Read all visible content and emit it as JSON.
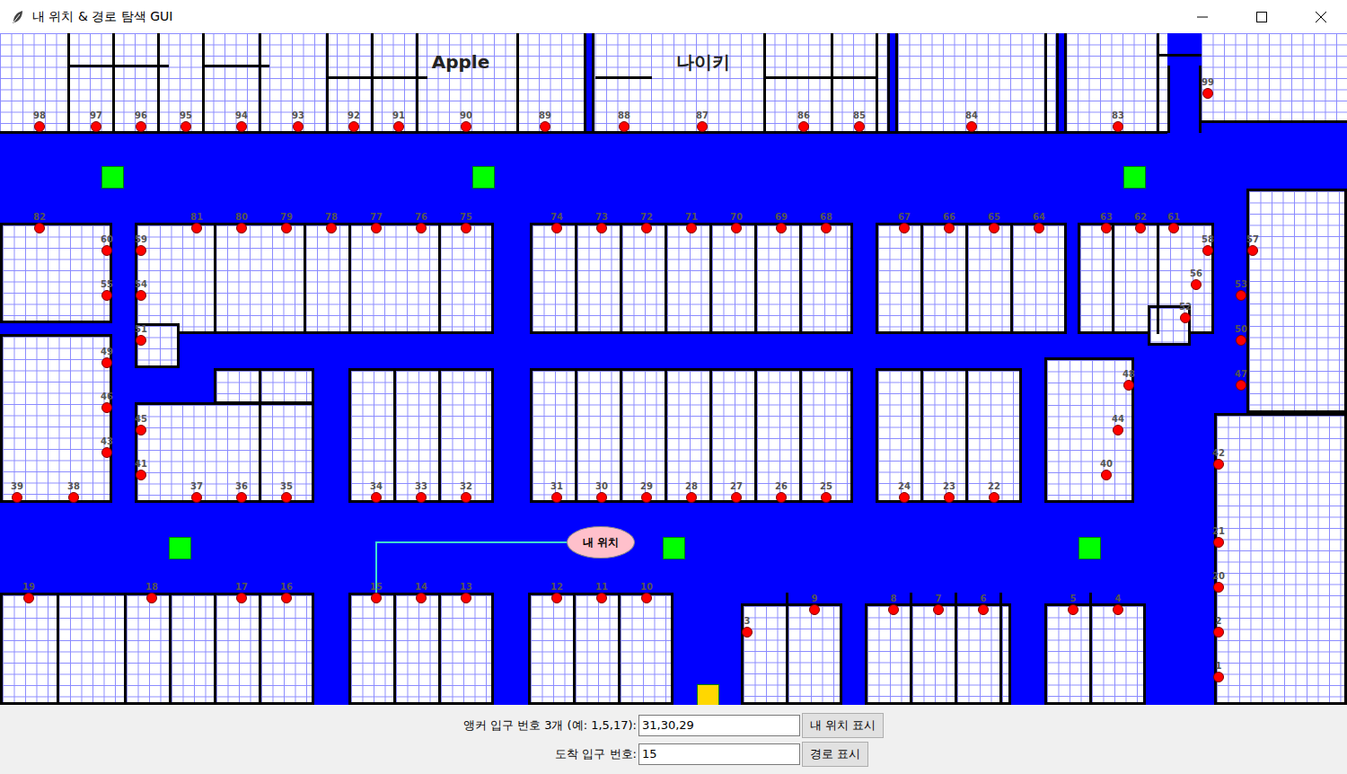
{
  "window": {
    "title": "내 위치 & 경로 탐색 GUI"
  },
  "map": {
    "brands": [
      {
        "label": "Apple"
      },
      {
        "label": "나이키"
      }
    ],
    "entrances": [
      {
        "label": "1"
      },
      {
        "label": "2"
      },
      {
        "label": "3"
      },
      {
        "label": "4"
      },
      {
        "label": "5"
      },
      {
        "label": "6"
      },
      {
        "label": "7"
      },
      {
        "label": "8"
      },
      {
        "label": "9"
      },
      {
        "label": "10"
      },
      {
        "label": "11"
      },
      {
        "label": "12"
      },
      {
        "label": "13"
      },
      {
        "label": "14"
      },
      {
        "label": "15"
      },
      {
        "label": "16"
      },
      {
        "label": "17"
      },
      {
        "label": "18"
      },
      {
        "label": "19"
      },
      {
        "label": "20"
      },
      {
        "label": "21"
      },
      {
        "label": "22"
      },
      {
        "label": "23"
      },
      {
        "label": "24"
      },
      {
        "label": "25"
      },
      {
        "label": "26"
      },
      {
        "label": "27"
      },
      {
        "label": "28"
      },
      {
        "label": "29"
      },
      {
        "label": "30"
      },
      {
        "label": "31"
      },
      {
        "label": "32"
      },
      {
        "label": "33"
      },
      {
        "label": "34"
      },
      {
        "label": "35"
      },
      {
        "label": "36"
      },
      {
        "label": "37"
      },
      {
        "label": "38"
      },
      {
        "label": "39"
      },
      {
        "label": "40"
      },
      {
        "label": "41"
      },
      {
        "label": "42"
      },
      {
        "label": "43"
      },
      {
        "label": "44"
      },
      {
        "label": "45"
      },
      {
        "label": "46"
      },
      {
        "label": "47"
      },
      {
        "label": "48"
      },
      {
        "label": "49"
      },
      {
        "label": "50"
      },
      {
        "label": "51"
      },
      {
        "label": "52"
      },
      {
        "label": "53"
      },
      {
        "label": "54"
      },
      {
        "label": "55"
      },
      {
        "label": "56"
      },
      {
        "label": "57"
      },
      {
        "label": "58"
      },
      {
        "label": "59"
      },
      {
        "label": "60"
      },
      {
        "label": "61"
      },
      {
        "label": "62"
      },
      {
        "label": "63"
      },
      {
        "label": "64"
      },
      {
        "label": "65"
      },
      {
        "label": "66"
      },
      {
        "label": "67"
      },
      {
        "label": "68"
      },
      {
        "label": "69"
      },
      {
        "label": "70"
      },
      {
        "label": "71"
      },
      {
        "label": "72"
      },
      {
        "label": "73"
      },
      {
        "label": "74"
      },
      {
        "label": "75"
      },
      {
        "label": "76"
      },
      {
        "label": "77"
      },
      {
        "label": "78"
      },
      {
        "label": "79"
      },
      {
        "label": "80"
      },
      {
        "label": "81"
      },
      {
        "label": "82"
      },
      {
        "label": "83"
      },
      {
        "label": "84"
      },
      {
        "label": "85"
      },
      {
        "label": "86"
      },
      {
        "label": "87"
      },
      {
        "label": "88"
      },
      {
        "label": "89"
      },
      {
        "label": "90"
      },
      {
        "label": "91"
      },
      {
        "label": "92"
      },
      {
        "label": "93"
      },
      {
        "label": "94"
      },
      {
        "label": "95"
      },
      {
        "label": "96"
      },
      {
        "label": "97"
      },
      {
        "label": "98"
      },
      {
        "label": "99"
      }
    ],
    "markers": [
      {
        "color": "#00ff00"
      },
      {
        "color": "#00ff00"
      },
      {
        "color": "#00ff00"
      },
      {
        "color": "#00ff00"
      },
      {
        "color": "#00ff00"
      },
      {
        "color": "#00ff00"
      },
      {
        "color": "#ffd700"
      }
    ],
    "current_location": {
      "label": "내 위치"
    }
  },
  "controls": {
    "anchor_label": "앵커 입구 번호 3개 (예: 1,5,17):",
    "anchor_value": "31,30,29",
    "locate_button": "내 위치 표시",
    "destination_label": "도착 입구 번호:",
    "destination_value": "15",
    "route_button": "경로 표시"
  }
}
